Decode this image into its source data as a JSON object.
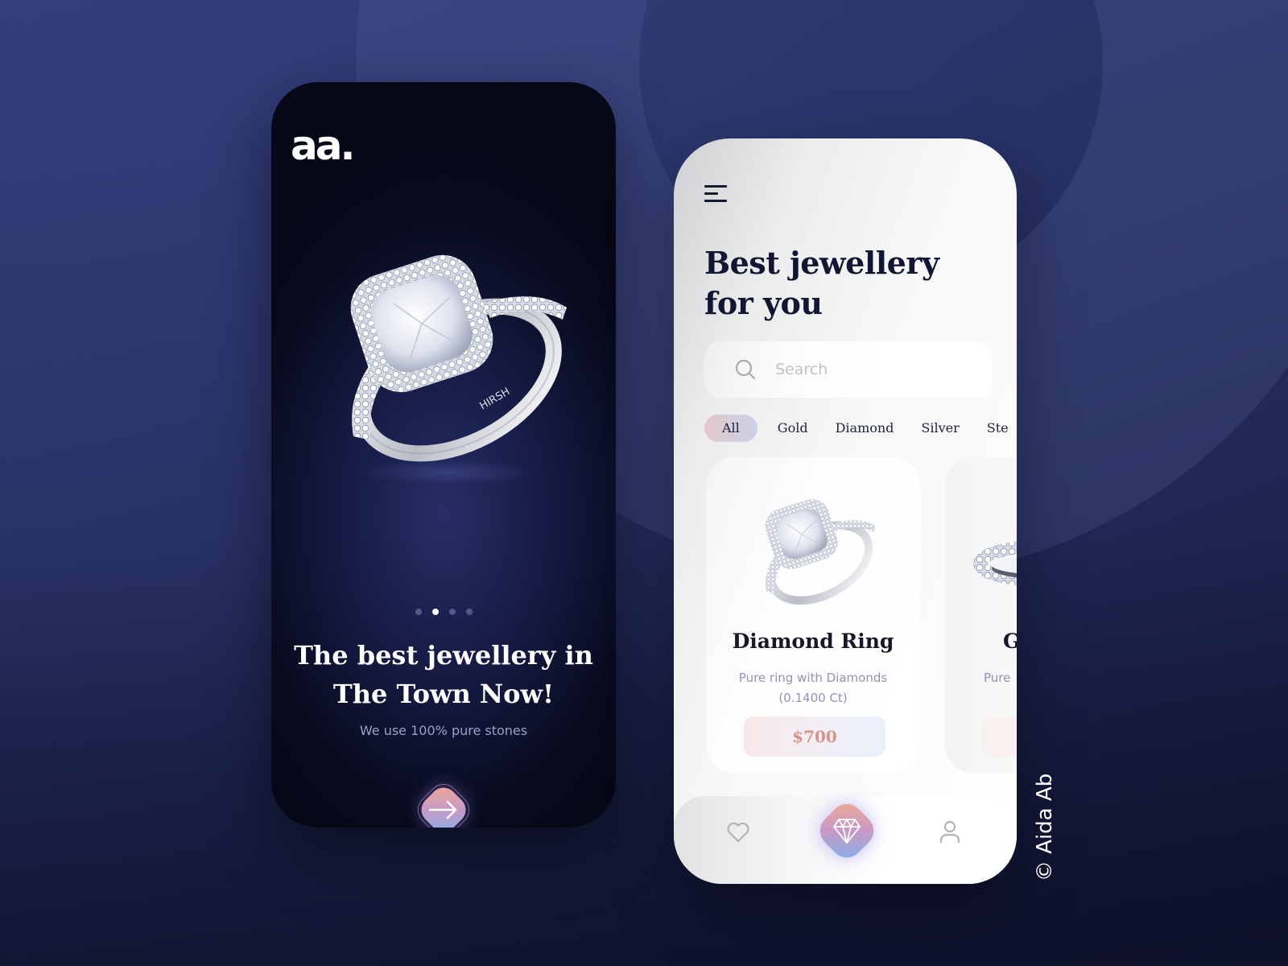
{
  "theme": {
    "accent_gradient": [
      "#f3a98a",
      "#c79ac6",
      "#7fb1ec"
    ],
    "dark_bg": "#080b1e",
    "light_bg": "#ffffff",
    "price_color": "#d8938a",
    "muted_text": "#9492b8"
  },
  "onboarding": {
    "logo": "aa.",
    "hero_image_icon": "diamond-ring-image",
    "pager": {
      "total": 4,
      "active_index": 1
    },
    "title": "The best jewellery in The Town Now!",
    "subtitle": "We use 100% pure stones",
    "next_button_icon": "arrow-right-icon"
  },
  "catalogue": {
    "menu_icon": "hamburger-menu-icon",
    "title_line1": "Best jewellery",
    "title_line2": "for you",
    "search": {
      "placeholder": "Search",
      "value": ""
    },
    "categories": [
      {
        "label": "All",
        "active": true
      },
      {
        "label": "Gold",
        "active": false
      },
      {
        "label": "Diamond",
        "active": false
      },
      {
        "label": "Silver",
        "active": false
      },
      {
        "label": "Ste",
        "active": false
      }
    ],
    "products": [
      {
        "name": "Diamond Ring",
        "description": "Pure ring with Diamonds (0.1400 Ct)",
        "price": "$700",
        "image_icon": "diamond-ring-image"
      },
      {
        "name": "G",
        "description": "Pure",
        "price": "",
        "image_icon": "eternity-band-image"
      }
    ],
    "bottom_nav": [
      {
        "icon": "heart-icon",
        "active": false
      },
      {
        "icon": "diamond-icon",
        "active": true
      },
      {
        "icon": "user-icon",
        "active": false
      }
    ]
  },
  "credit": "© Aida Ab"
}
